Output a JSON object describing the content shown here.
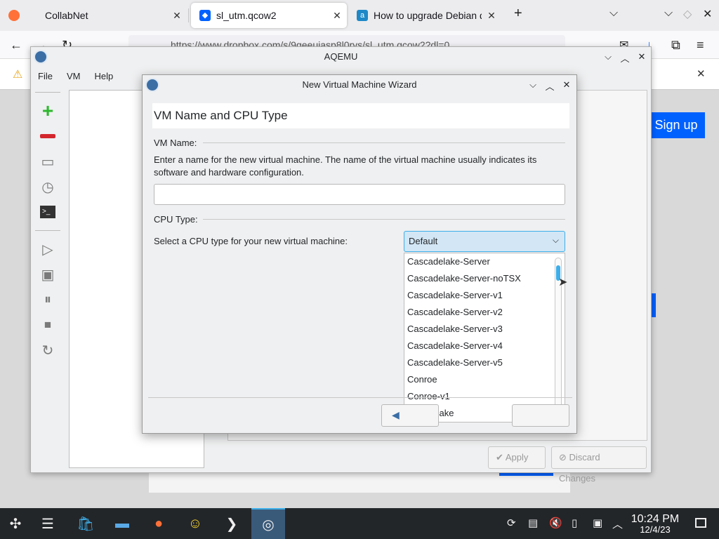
{
  "browser": {
    "tabs": [
      {
        "title": "CollabNet",
        "icon": "firefox-icon",
        "close": "✕"
      },
      {
        "title": "sl_utm.qcow2",
        "icon": "dropbox-icon",
        "close": "✕"
      },
      {
        "title": "How to upgrade Debian dr",
        "icon": "askubuntu-icon",
        "close": "✕"
      }
    ],
    "new_tab_label": "+",
    "url": "https://www.dropbox.com/s/9geeuiasp8l0rys/sl_utm.qcow2?dl=0",
    "page_signup_label": "Sign up"
  },
  "aqemu": {
    "title": "AQEMU",
    "menu": [
      "File",
      "VM",
      "Help"
    ],
    "apply_label": "Apply",
    "discard_label": "Discard Changes"
  },
  "wizard": {
    "title": "New Virtual Machine Wizard",
    "heading": "VM Name and CPU Type",
    "vm_name_group": "VM Name:",
    "vm_name_description": "Enter a name for the new virtual machine. The name of the virtual machine usually indicates its software and hardware configuration.",
    "vm_name_value": "",
    "cpu_group": "CPU Type:",
    "cpu_prompt": "Select a CPU type for your new virtual machine:",
    "cpu_selected": "Default",
    "cpu_options": [
      "Cascadelake-Server",
      "Cascadelake-Server-noTSX",
      "Cascadelake-Server-v1",
      "Cascadelake-Server-v2",
      "Cascadelake-Server-v3",
      "Cascadelake-Server-v4",
      "Cascadelake-Server-v5",
      "Conroe",
      "Conroe-v1",
      "Cooperlake"
    ]
  },
  "taskbar": {
    "time": "10:24 PM",
    "date": "12/4/23"
  },
  "colors": {
    "accent": "#3daee9",
    "dropbox_blue": "#0061fe",
    "taskbar_bg": "#232629"
  }
}
